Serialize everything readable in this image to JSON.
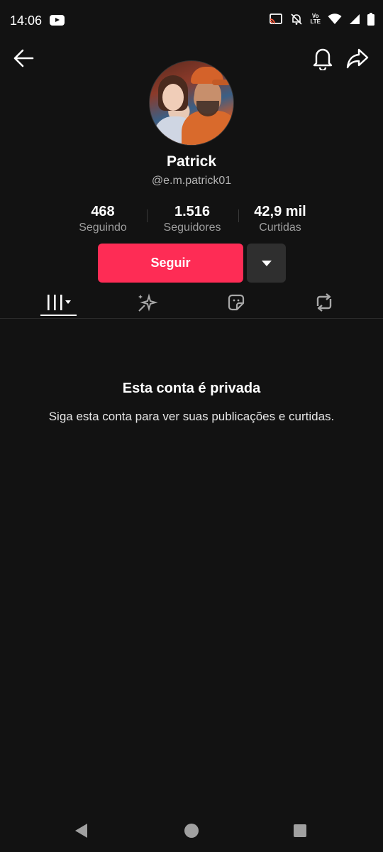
{
  "status_bar": {
    "time": "14:06",
    "icons": [
      "youtube-icon",
      "cast-icon",
      "bell-off-icon",
      "volte-icon",
      "wifi-icon",
      "signal-icon",
      "battery-icon"
    ],
    "volte_top": "Vo",
    "volte_bottom": "LTE"
  },
  "profile": {
    "name": "Patrick",
    "handle": "@e.m.patrick01",
    "stats": [
      {
        "value": "468",
        "label": "Seguindo"
      },
      {
        "value": "1.516",
        "label": "Seguidores"
      },
      {
        "value": "42,9 mil",
        "label": "Curtidas"
      }
    ]
  },
  "actions": {
    "follow_label": "Seguir"
  },
  "tabs": [
    "videos-grid-icon",
    "reposts-sparkle-icon",
    "sticker-icon",
    "repost-arrows-icon"
  ],
  "private_notice": {
    "title": "Esta conta é privada",
    "subtitle": "Siga esta conta para ver suas publicações e curtidas."
  },
  "colors": {
    "background": "#121212",
    "accent": "#fe2c55",
    "secondary_button": "#2f2f2f"
  }
}
